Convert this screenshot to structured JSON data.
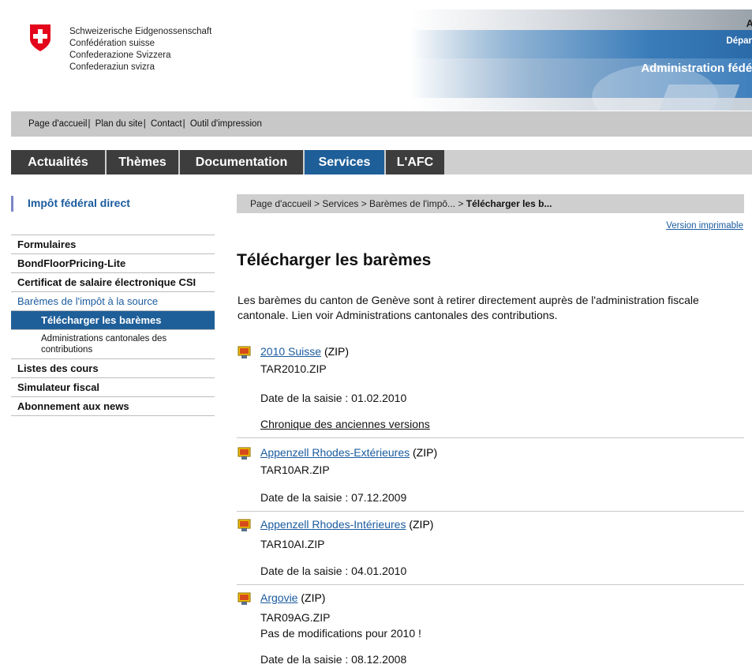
{
  "header": {
    "confederation": [
      "Schweizerische Eidgenossenschaft",
      "Confédération suisse",
      "Confederazione Svizzera",
      "Confederaziun svizra"
    ],
    "banner_letter": "A",
    "department": "Dépar",
    "administration": "Administration fédér"
  },
  "service_bar": {
    "links": [
      "Page d'accueil",
      "Plan du site",
      "Contact",
      "Outil d'impression"
    ]
  },
  "nav": {
    "tabs": [
      "Actualités",
      "Thèmes",
      "Documentation",
      "Services",
      "L'AFC"
    ],
    "active": "Services"
  },
  "sidebar": {
    "title": "Impôt fédéral direct",
    "items": [
      "Formulaires",
      "BondFloorPricing-Lite",
      "Certificat de salaire électronique CSI",
      "Barèmes de l'impôt à la source",
      "Télécharger les barèmes",
      "Administrations cantonales des contributions",
      "Listes des cours",
      "Simulateur fiscal",
      "Abonnement aux news"
    ]
  },
  "breadcrumb": {
    "path": "Page d'accueil > Services > Barèmes de l'impô... > ",
    "current": "Télécharger les b..."
  },
  "printable_link": "Version imprimable",
  "page": {
    "title": "Télécharger les barèmes",
    "intro": "Les barèmes du canton de Genève sont à retirer directement auprès de l'administration fiscale cantonale. Lien voir Administrations cantonales des contributions."
  },
  "downloads": [
    {
      "link": "2010 Suisse",
      "type": " (ZIP)",
      "file": "TAR2010.ZIP",
      "date": "Date de la saisie : 01.02.2010",
      "history_link": "Chronique des anciennes versions"
    },
    {
      "link": "Appenzell Rhodes-Extérieures",
      "type": " (ZIP)",
      "file": "TAR10AR.ZIP",
      "date": "Date de la saisie : 07.12.2009"
    },
    {
      "link": "Appenzell Rhodes-Intérieures",
      "type": " (ZIP)",
      "file": "TAR10AI.ZIP",
      "date": "Date de la saisie : 04.01.2010"
    },
    {
      "link": "Argovie",
      "type": " (ZIP)",
      "file": "TAR09AG.ZIP",
      "note": "Pas de modifications pour 2010 !",
      "date": "Date de la saisie : 08.12.2008"
    }
  ],
  "colors": {
    "nav_bg": "#3d3d3d",
    "nav_active": "#1f5f99",
    "link": "#1a5b9e",
    "bar_grey": "#cfcfcf"
  }
}
